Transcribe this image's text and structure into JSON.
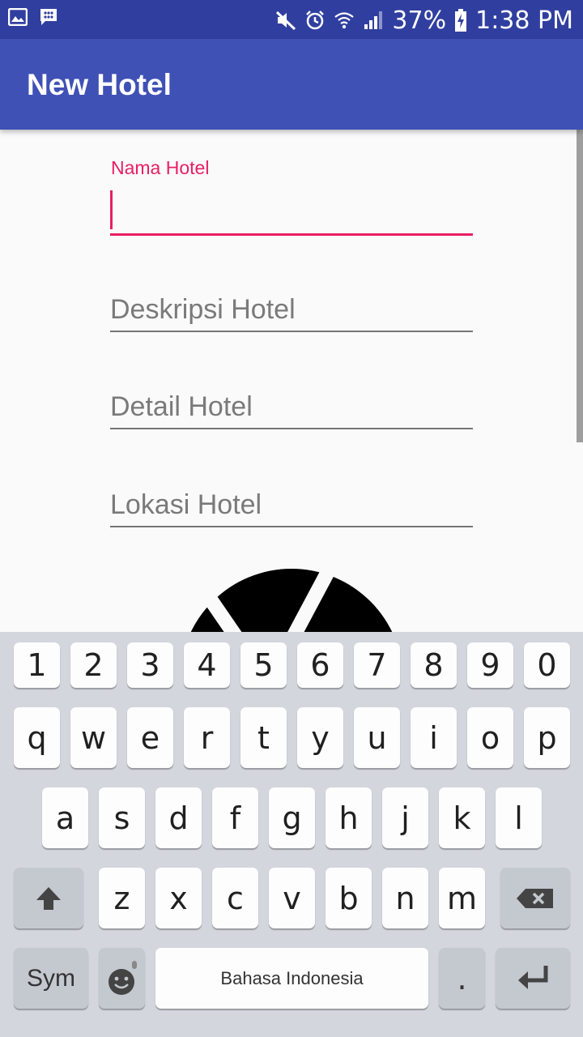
{
  "status_bar": {
    "battery": "37%",
    "time": "1:38 PM",
    "icons": [
      "image-notification-icon",
      "bbm-icon",
      "mute-icon",
      "alarm-icon",
      "wifi-icon",
      "signal-icon",
      "battery-charging-icon"
    ]
  },
  "app_bar": {
    "title": "New Hotel"
  },
  "form": {
    "nama_label": "Nama Hotel",
    "nama_value": "",
    "deskripsi_placeholder": "Deskripsi Hotel",
    "detail_placeholder": "Detail Hotel",
    "lokasi_placeholder": "Lokasi Hotel",
    "image_icon": "camera-aperture-icon"
  },
  "keyboard": {
    "numbers": [
      "1",
      "2",
      "3",
      "4",
      "5",
      "6",
      "7",
      "8",
      "9",
      "0"
    ],
    "row1": [
      "q",
      "w",
      "e",
      "r",
      "t",
      "y",
      "u",
      "i",
      "o",
      "p"
    ],
    "row2": [
      "a",
      "s",
      "d",
      "f",
      "g",
      "h",
      "j",
      "k",
      "l"
    ],
    "row3": [
      "z",
      "x",
      "c",
      "v",
      "b",
      "n",
      "m"
    ],
    "sym_label": "Sym",
    "space_label": "Bahasa Indonesia",
    "period_label": ".",
    "colors": {
      "background": "#d3d6dd",
      "key": "#fdfdfd",
      "func_key": "#c4c8cf"
    }
  },
  "colors": {
    "primary": "#3f51b5",
    "primary_dark": "#303f9f",
    "accent": "#e91e63"
  }
}
